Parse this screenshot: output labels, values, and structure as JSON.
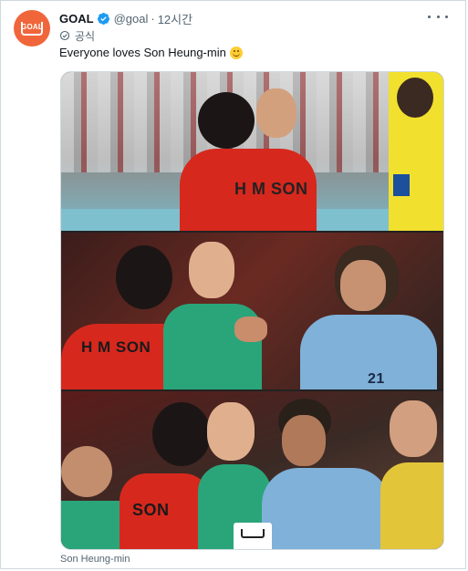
{
  "tweet": {
    "author_name": "GOAL",
    "avatar_text": "GOAL",
    "handle": "@goal",
    "separator": "·",
    "time": "12시간",
    "official_label": "공식",
    "text": "Everyone loves Son Heung-min",
    "emoji_icon": "smiling-face-emoji",
    "media_caption": "Son Heung-min"
  },
  "media": {
    "jersey_text_top": "H M SON",
    "jersey_text_middle": "H M SON",
    "jersey_text_bottom": "SON",
    "jersey_number_middle": "21"
  },
  "colors": {
    "avatar_bg": "#f0663a",
    "verified_blue": "#1d9bf0",
    "korea_red": "#d7281e",
    "uruguay_blue": "#7fb1d9"
  }
}
